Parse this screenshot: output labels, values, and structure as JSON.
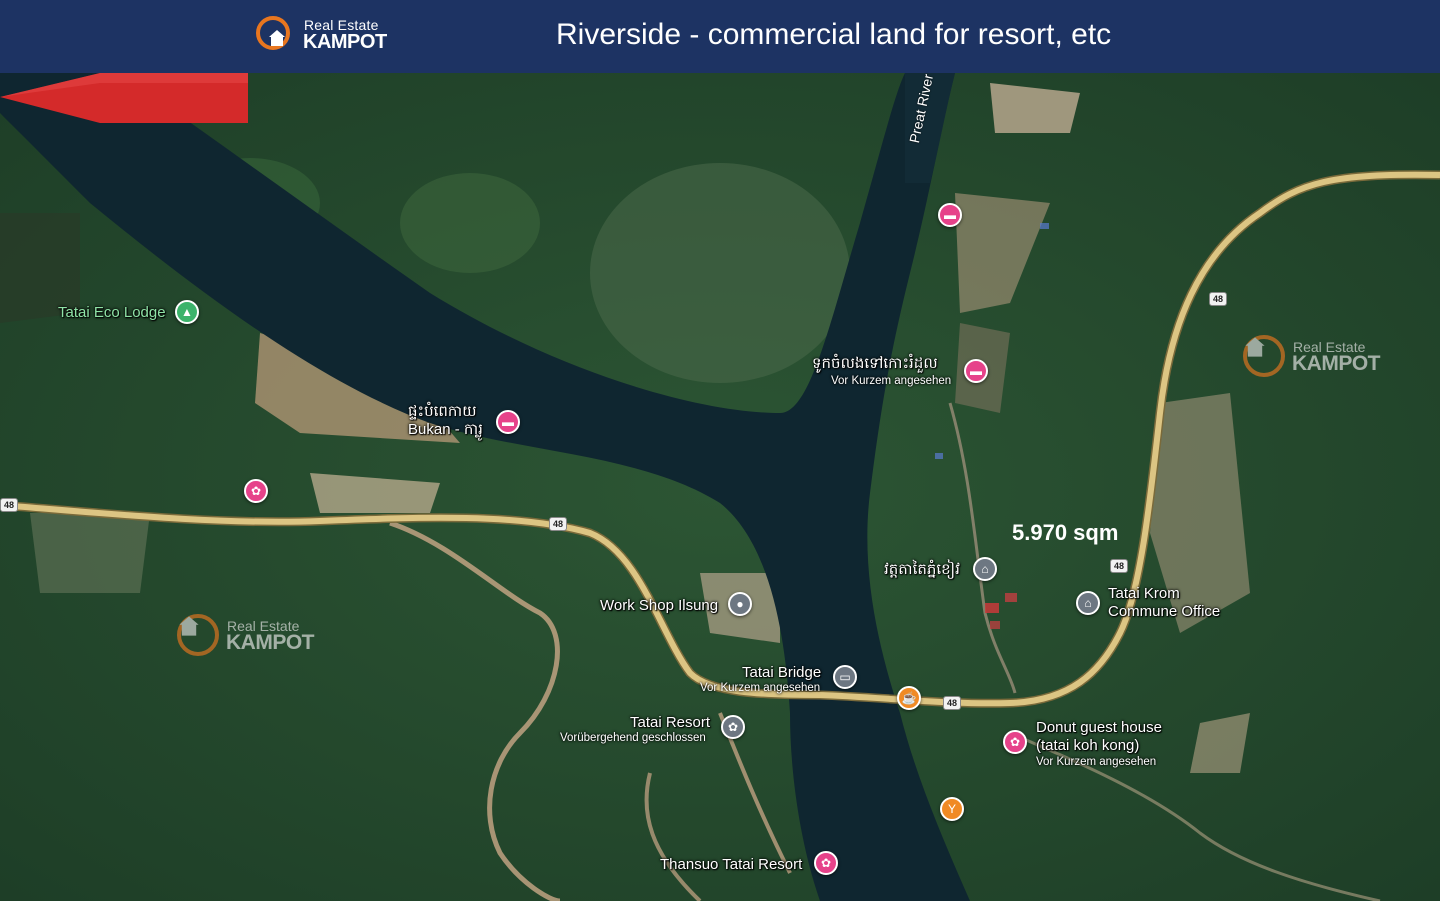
{
  "header": {
    "logo": {
      "line1": "Real Estate",
      "line2": "KAMPOT"
    },
    "title": "Riverside - commercial land for resort, etc"
  },
  "colors": {
    "header_bg": "#1d3363",
    "brand_orange": "#e8761f",
    "highlight_red": "#d42a2a",
    "road": "#d8c27a",
    "river": "#0f2630"
  },
  "map": {
    "river_name": "Preat River",
    "road_number": "48",
    "highlight": {
      "label": "5.970 sqm"
    },
    "watermark": {
      "line1": "Real Estate",
      "line2": "KAMPOT"
    },
    "places": {
      "tatai_eco_lodge": {
        "name": "Tatai Eco Lodge",
        "icon": "campground-icon"
      },
      "boat_km": {
        "name": "ទូកចំលងទៅកោះរំដួល",
        "sub": "Vor Kurzem angesehen",
        "icon": "hotel-icon"
      },
      "bukan": {
        "name": "ផ្ទះបំពេកាយ",
        "name2": "Bukan - ការ្លូ",
        "icon": "hotel-icon"
      },
      "wat": {
        "name": "វត្តតាតៃភ្នំខៀវ",
        "icon": "temple-icon"
      },
      "tatai_krom": {
        "name": "Tatai Krom",
        "name2": "Commune Office",
        "icon": "government-icon"
      },
      "work_shop": {
        "name": "Work Shop Ilsung",
        "icon": "location-icon"
      },
      "tatai_bridge": {
        "name": "Tatai Bridge",
        "sub": "Vor Kurzem angesehen",
        "icon": "bridge-icon"
      },
      "tatai_resort": {
        "name": "Tatai Resort",
        "sub": "Vorübergehend geschlossen",
        "icon": "resort-icon"
      },
      "donut": {
        "name": "Donut guest house",
        "name2": "(tatai koh kong)",
        "sub": "Vor Kurzem angesehen",
        "icon": "resort-icon"
      },
      "thansuo": {
        "name": "Thansuo Tatai Resort",
        "icon": "resort-icon"
      }
    }
  }
}
